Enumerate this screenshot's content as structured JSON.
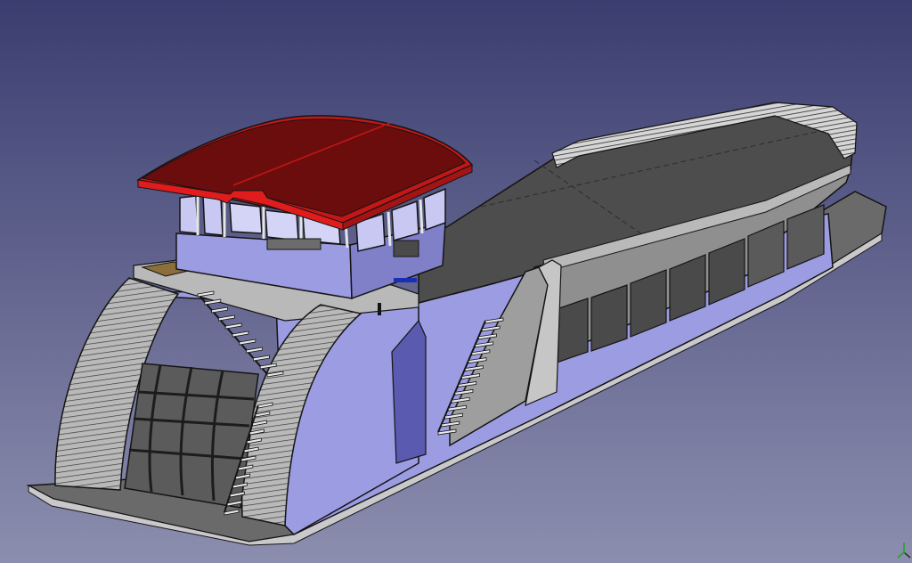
{
  "viewport": {
    "background_top": "#3b3d70",
    "background_bottom": "#8c8eaf"
  },
  "colors": {
    "roof_top": "#c41616",
    "roof_dark": "#6c0d0d",
    "wall_lavender": "#9c9ce2",
    "wall_lavender_dark": "#7f80c7",
    "deck_dark": "#4a4a4a",
    "deck_mid": "#5c5c5c",
    "panel_grey": "#8f8f8f",
    "panel_light": "#b9b9b9",
    "hull_bottom": "#c9c9cc",
    "edge": "#141414"
  },
  "icons": {
    "axis_indicator": "xyz-axis-icon"
  }
}
